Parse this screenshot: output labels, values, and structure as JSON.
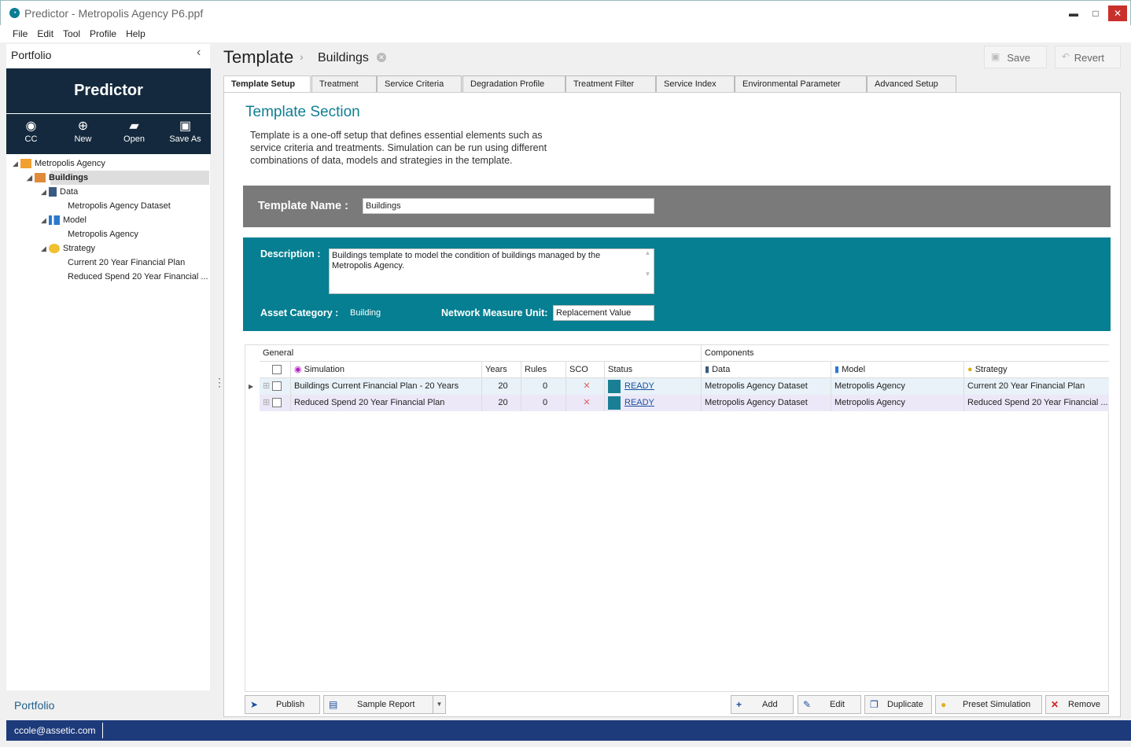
{
  "window": {
    "title": "Predictor - Metropolis Agency P6.ppf",
    "min": "▬",
    "max": "□",
    "close": "✕"
  },
  "menu": [
    "File",
    "Edit",
    "Tool",
    "Profile",
    "Help"
  ],
  "sidebar": {
    "heading": "Portfolio",
    "brand": "Predictor",
    "tools": [
      {
        "label": "CC",
        "icon": "user-icon"
      },
      {
        "label": "New",
        "icon": "plus-icon"
      },
      {
        "label": "Open",
        "icon": "folder-icon"
      },
      {
        "label": "Save As",
        "icon": "save-icon"
      }
    ],
    "tree": {
      "agency": "Metropolis Agency",
      "buildings": "Buildings",
      "data": "Data",
      "dataset": "Metropolis Agency Dataset",
      "model": "Model",
      "model_item": "Metropolis Agency",
      "strategy": "Strategy",
      "strategy_1": "Current 20 Year Financial Plan",
      "strategy_2": "Reduced Spend 20 Year Financial ..."
    },
    "footer": "Portfolio"
  },
  "status": {
    "user": "ccole@assetic.com"
  },
  "header": {
    "crumb_root": "Template",
    "crumb_item": "Buildings",
    "save": "Save",
    "revert": "Revert"
  },
  "tabs": [
    "Template Setup",
    "Treatment",
    "Service Criteria",
    "Degradation Profile",
    "Treatment Filter",
    "Service Index",
    "Environmental Parameter",
    "Advanced Setup"
  ],
  "section": {
    "title": "Template Section",
    "description": "Template is a one-off setup that defines essential elements such as service criteria and treatments. Simulation can be run using different combinations of data, models and strategies in the template."
  },
  "form": {
    "name_label": "Template Name :",
    "name_value": "Buildings",
    "desc_label": "Description :",
    "desc_value": "Buildings template to model the condition of buildings managed by the Metropolis Agency.",
    "cat_label": "Asset Category :",
    "cat_value": "Building",
    "nmu_label": "Network Measure Unit:",
    "nmu_value": "Replacement Value"
  },
  "grid": {
    "group_general": "General",
    "group_components": "Components",
    "cols": {
      "simulation": "Simulation",
      "years": "Years",
      "rules": "Rules",
      "sco": "SCO",
      "status": "Status",
      "data": "Data",
      "model": "Model",
      "strategy": "Strategy"
    },
    "rows": [
      {
        "simulation": "Buildings Current Financial Plan - 20 Years",
        "years": "20",
        "rules": "0",
        "sco": "✕",
        "status": "READY",
        "data": "Metropolis Agency Dataset",
        "model": "Metropolis Agency",
        "strategy": "Current 20 Year Financial Plan"
      },
      {
        "simulation": "Reduced Spend 20 Year Financial Plan",
        "years": "20",
        "rules": "0",
        "sco": "✕",
        "status": "READY",
        "data": "Metropolis Agency Dataset",
        "model": "Metropolis Agency",
        "strategy": "Reduced Spend 20 Year Financial ..."
      }
    ]
  },
  "actions": {
    "publish": "Publish",
    "sample_report": "Sample Report",
    "add": "Add",
    "edit": "Edit",
    "duplicate": "Duplicate",
    "preset": "Preset Simulation",
    "remove": "Remove"
  },
  "colors": {
    "brand_dark": "#14293d",
    "teal": "#057f91",
    "status_bar": "#1d3a7a",
    "grey_band": "#7a7a7a"
  }
}
